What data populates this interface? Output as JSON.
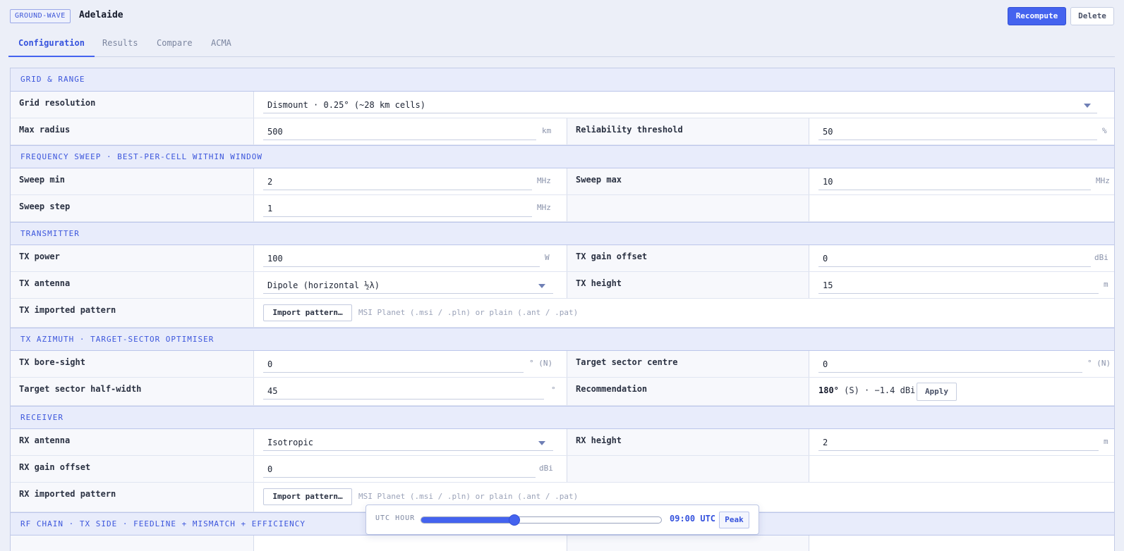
{
  "header": {
    "badge": "GROUND-WAVE",
    "title": "Adelaide",
    "recompute_label": "Recompute",
    "delete_label": "Delete"
  },
  "tabs": [
    {
      "label": "Configuration",
      "active": true
    },
    {
      "label": "Results",
      "active": false
    },
    {
      "label": "Compare",
      "active": false
    },
    {
      "label": "ACMA",
      "active": false
    }
  ],
  "sections": {
    "grid": "GRID & RANGE",
    "freq": "FREQUENCY SWEEP · BEST-PER-CELL WITHIN WINDOW",
    "tx": "TRANSMITTER",
    "azimuth": "TX AZIMUTH · TARGET-SECTOR OPTIMISER",
    "rx": "RECEIVER",
    "rfchain": "RF CHAIN · TX SIDE · FEEDLINE + MISMATCH + EFFICIENCY"
  },
  "fields": {
    "grid_resolution": {
      "label": "Grid resolution",
      "value": "Dismount · 0.25° (~28 km cells)"
    },
    "max_radius": {
      "label": "Max radius",
      "value": "500",
      "unit": "km"
    },
    "reliability": {
      "label": "Reliability threshold",
      "value": "50",
      "unit": "%"
    },
    "sweep_min": {
      "label": "Sweep min",
      "value": "2",
      "unit": "MHz"
    },
    "sweep_max": {
      "label": "Sweep max",
      "value": "10",
      "unit": "MHz"
    },
    "sweep_step": {
      "label": "Sweep step",
      "value": "1",
      "unit": "MHz"
    },
    "tx_power": {
      "label": "TX power",
      "value": "100",
      "unit": "W"
    },
    "tx_gain": {
      "label": "TX gain offset",
      "value": "0",
      "unit": "dBi"
    },
    "tx_antenna": {
      "label": "TX antenna",
      "value": "Dipole (horizontal ½λ)"
    },
    "tx_height": {
      "label": "TX height",
      "value": "15",
      "unit": "m"
    },
    "tx_pattern": {
      "label": "TX imported pattern",
      "button": "Import pattern…",
      "hint": "MSI Planet (.msi / .pln) or plain (.ant / .pat)"
    },
    "tx_boresight": {
      "label": "TX bore-sight",
      "value": "0",
      "unit": "° (N)"
    },
    "sector_centre": {
      "label": "Target sector centre",
      "value": "0",
      "unit": "° (N)"
    },
    "sector_halfwidth": {
      "label": "Target sector half-width",
      "value": "45",
      "unit": "°"
    },
    "recommendation": {
      "label": "Recommendation",
      "bearing": "180°",
      "detail": " (S) · −1.4 dBi",
      "apply": "Apply"
    },
    "rx_antenna": {
      "label": "RX antenna",
      "value": "Isotropic"
    },
    "rx_height": {
      "label": "RX height",
      "value": "2",
      "unit": "m"
    },
    "rx_gain": {
      "label": "RX gain offset",
      "value": "0",
      "unit": "dBi"
    },
    "rx_pattern": {
      "label": "RX imported pattern",
      "button": "Import pattern…",
      "hint": "MSI Planet (.msi / .pln) or plain (.ant / .pat)"
    }
  },
  "utc": {
    "label": "UTC HOUR",
    "value": "09:00 UTC",
    "hour_fraction": 0.39,
    "peak_label": "Peak"
  }
}
